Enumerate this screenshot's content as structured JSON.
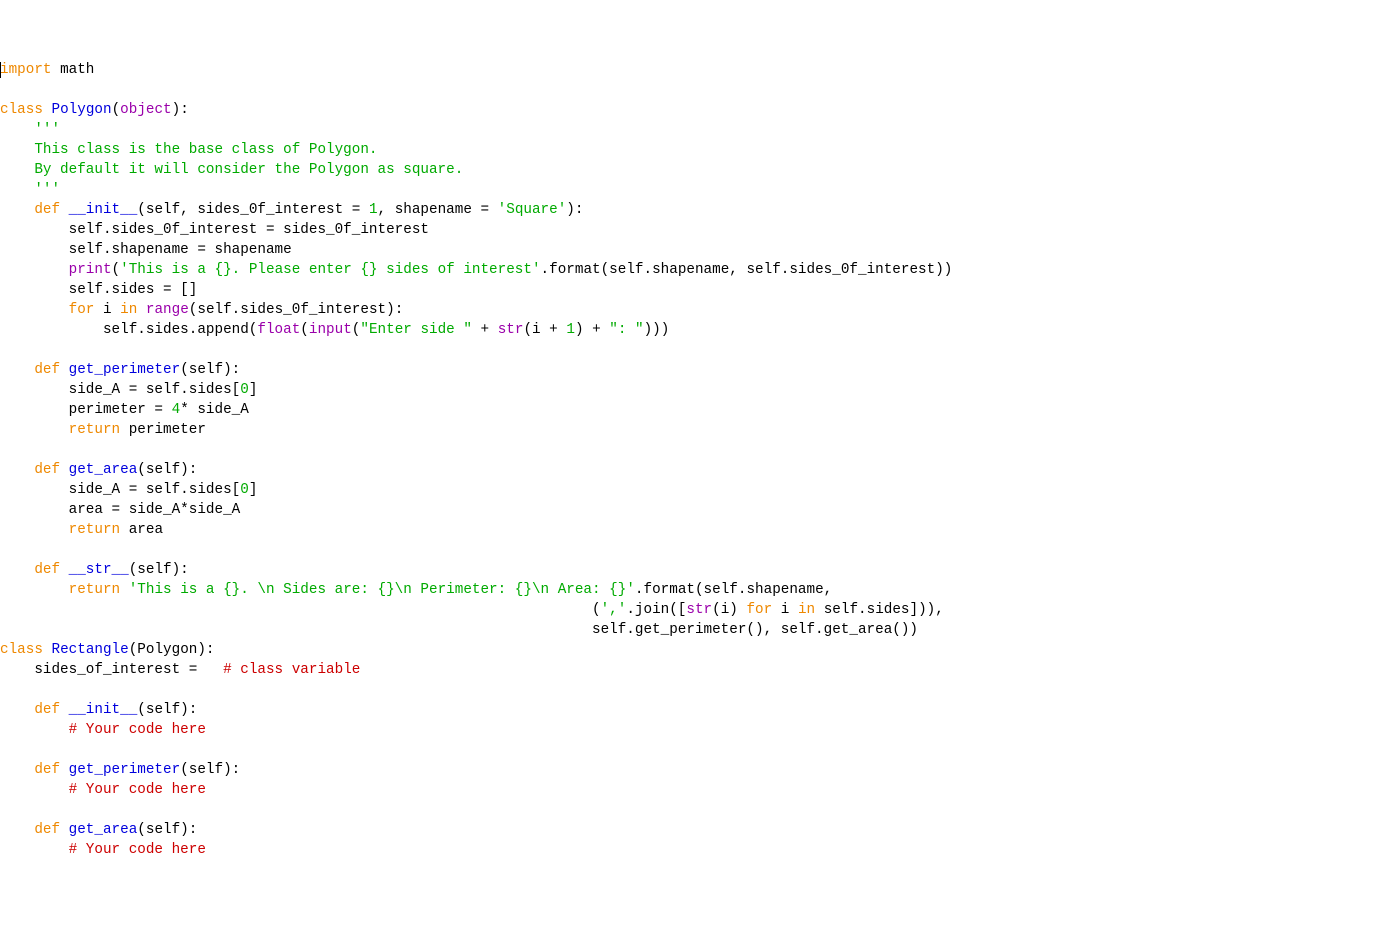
{
  "code": {
    "l1_import": "import",
    "l1_math": " math",
    "l3_class": "class",
    "l3_space": " ",
    "l3_polygon": "Polygon",
    "l3_paren_open": "(",
    "l3_object": "object",
    "l3_paren_close": "):",
    "l4_doc1": "    '''",
    "l5_doc2": "    This class is the base class of Polygon.",
    "l6_doc3": "    By default it will consider the Polygon as square.",
    "l7_doc4": "    '''",
    "l8_def": "    def",
    "l8_init": " __init__",
    "l8_params_open": "(self, sides_0f_interest = ",
    "l8_num1": "1",
    "l8_comma": ", shapename = ",
    "l8_sq": "'Square'",
    "l8_close": "):",
    "l9": "        self.sides_0f_interest = sides_0f_interest",
    "l10": "        self.shapename = shapename",
    "l11_print": "        print",
    "l11_paren": "(",
    "l11_str": "'This is a {}. Please enter {} sides of interest'",
    "l11_format": ".format(self.shapename, self.sides_0f_interest))",
    "l12": "        self.sides = []",
    "l13_for": "        for",
    "l13_i": " i ",
    "l13_in": "in",
    "l13_range": " range",
    "l13_rest": "(self.sides_0f_interest):",
    "l14_pre": "            self.sides.append(",
    "l14_float": "float",
    "l14_paren": "(",
    "l14_input": "input",
    "l14_paren2": "(",
    "l14_str": "\"Enter side \"",
    "l14_plus": " + ",
    "l14_str_fn": "str",
    "l14_iarg": "(i + ",
    "l14_one": "1",
    "l14_close1": ") + ",
    "l14_colon": "\": \"",
    "l14_close2": ")))",
    "l16_def": "    def",
    "l16_name": " get_perimeter",
    "l16_params": "(self):",
    "l17": "        side_A = self.sides[",
    "l17_zero": "0",
    "l17_close": "]",
    "l18_pre": "        perimeter = ",
    "l18_four": "4",
    "l18_rest": "* side_A",
    "l19_return": "        return",
    "l19_rest": " perimeter",
    "l21_def": "    def",
    "l21_name": " get_area",
    "l21_params": "(self):",
    "l22": "        side_A = self.sides[",
    "l22_zero": "0",
    "l22_close": "]",
    "l23": "        area = side_A*side_A",
    "l24_return": "        return",
    "l24_rest": " area",
    "l26_def": "    def",
    "l26_name": " __str__",
    "l26_params": "(self):",
    "l27_return": "        return",
    "l27_space": " ",
    "l27_str": "'This is a {}. \\n Sides are: {}\\n Perimeter: {}\\n Area: {}'",
    "l27_format": ".format(self.shapename,",
    "l28_pre": "                                                                     (",
    "l28_comma": "','",
    "l28_join": ".join([",
    "l28_str": "str",
    "l28_i": "(i) ",
    "l28_for": "for",
    "l28_i2": " i ",
    "l28_in": "in",
    "l28_rest": " self.sides])),",
    "l29": "                                                                     self.get_perimeter(), self.get_area())",
    "l30_class": "class",
    "l30_space": " ",
    "l30_rect": "Rectangle",
    "l30_params": "(Polygon):",
    "l31_pre": "    sides_of_interest =   ",
    "l31_comment": "# class variable",
    "l33_def": "    def",
    "l33_name": " __init__",
    "l33_params": "(self):",
    "l34_pre": "        ",
    "l34_comment": "# Your code here",
    "l36_def": "    def",
    "l36_name": " get_perimeter",
    "l36_params": "(self):",
    "l37_pre": "        ",
    "l37_comment": "# Your code here",
    "l39_def": "    def",
    "l39_name": " get_area",
    "l39_params": "(self):",
    "l40_pre": "        ",
    "l40_comment": "# Your code here"
  }
}
